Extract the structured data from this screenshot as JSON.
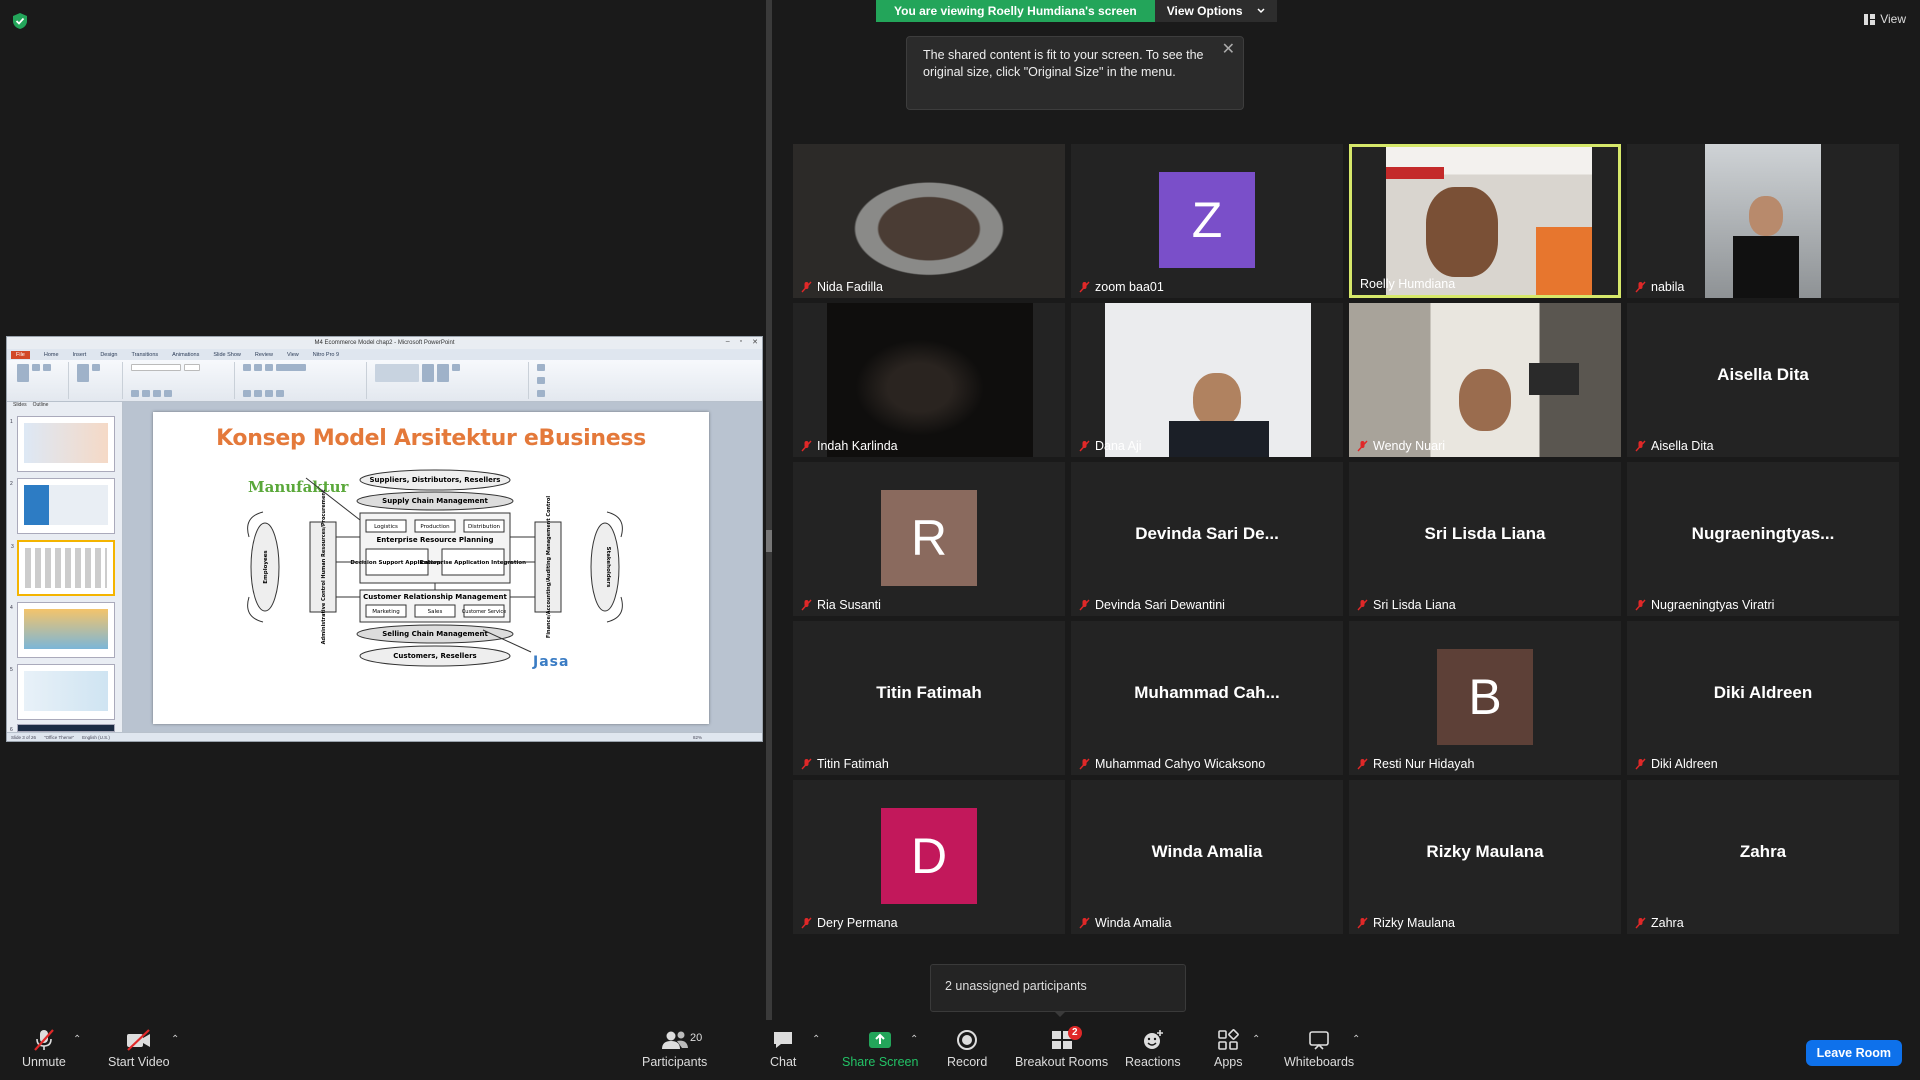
{
  "banner": {
    "viewing": "You are viewing Roelly Humdiana's screen",
    "view_options": "View Options",
    "notice": "The shared content is fit to your screen. To see the original size, click \"Original Size\" in the menu.",
    "view_label": "View"
  },
  "ppt": {
    "window_title": "M4 Ecommerce Model chap2 - Microsoft PowerPoint",
    "tabs": [
      "File",
      "Home",
      "Insert",
      "Design",
      "Transitions",
      "Animations",
      "Slide Show",
      "Review",
      "View",
      "Nitro Pro 9"
    ],
    "panel_tabs": [
      "Slides",
      "Outline"
    ],
    "slide_numbers": [
      "1",
      "2",
      "3",
      "4",
      "5",
      "6"
    ],
    "slide": {
      "title": "Konsep Model Arsitektur eBusiness",
      "manufaktur": "Manufaktur",
      "jasa": "Jasa",
      "boxes": {
        "suppliers": "Suppliers, Distributors, Resellers",
        "scm": "Supply Chain Management",
        "logistics": "Logistics",
        "production": "Production",
        "distribution": "Distribution",
        "erp": "Enterprise Resource Planning",
        "dss": "Decision Support Applications",
        "eai": "Enterprise Application Integration",
        "crm": "Customer Relationship Management",
        "marketing": "Marketing",
        "sales": "Sales",
        "service": "Customer Service",
        "sell_cm": "Selling Chain Management",
        "customers": "Customers, Resellers",
        "employees": "Employees",
        "admin": "Administrative Control Human Resources/Procurement",
        "finance": "Finance/Accounting/Auditing Management Control",
        "stakeholders": "Stakeholders"
      }
    },
    "status": [
      "Slide 3 of 26",
      "\"Office Theme\"",
      "English (U.S.)",
      "82%"
    ]
  },
  "participants": [
    {
      "name": "Nida Fadilla",
      "kind": "video",
      "muted": true
    },
    {
      "name": "zoom baa01",
      "kind": "avatar",
      "letter": "Z",
      "color": "#7a4fc9",
      "muted": true
    },
    {
      "name": "Roelly Humdiana",
      "kind": "video",
      "muted": false,
      "active": true
    },
    {
      "name": "nabila",
      "kind": "video",
      "muted": true
    },
    {
      "name": "Indah Karlinda",
      "kind": "video",
      "muted": true
    },
    {
      "name": "Dana Aji",
      "kind": "video",
      "muted": true
    },
    {
      "name": "Wendy Nuari",
      "kind": "video",
      "muted": true
    },
    {
      "name": "Aisella Dita",
      "kind": "text",
      "display": "Aisella Dita",
      "muted": true
    },
    {
      "name": "Ria Susanti",
      "kind": "avatar",
      "letter": "R",
      "color": "#8a6a5e",
      "muted": true
    },
    {
      "name": "Devinda Sari Dewantini",
      "kind": "text",
      "display": "Devinda Sari De...",
      "muted": true
    },
    {
      "name": "Sri Lisda Liana",
      "kind": "text",
      "display": "Sri Lisda Liana",
      "muted": true
    },
    {
      "name": "Nugraeningtyas Viratri",
      "kind": "text",
      "display": "Nugraeningtyas...",
      "muted": true
    },
    {
      "name": "Titin Fatimah",
      "kind": "text",
      "display": "Titin Fatimah",
      "muted": true
    },
    {
      "name": "Muhammad Cahyo Wicaksono",
      "kind": "text",
      "display": "Muhammad Cah...",
      "muted": true
    },
    {
      "name": "Resti Nur Hidayah",
      "kind": "avatar",
      "letter": "B",
      "color": "#5d4037",
      "muted": true
    },
    {
      "name": "Diki Aldreen",
      "kind": "text",
      "display": "Diki Aldreen",
      "muted": true
    },
    {
      "name": "Dery Permana",
      "kind": "avatar",
      "letter": "D",
      "color": "#c2185b",
      "muted": true
    },
    {
      "name": "Winda Amalia",
      "kind": "text",
      "display": "Winda Amalia",
      "muted": true
    },
    {
      "name": "Rizky Maulana",
      "kind": "text",
      "display": "Rizky Maulana",
      "muted": true
    },
    {
      "name": "Zahra",
      "kind": "text",
      "display": "Zahra",
      "muted": true
    }
  ],
  "unassigned": "2 unassigned participants",
  "toolbar": {
    "unmute": "Unmute",
    "start_video": "Start Video",
    "participants": "Participants",
    "participants_count": "20",
    "chat": "Chat",
    "share_screen": "Share Screen",
    "record": "Record",
    "breakout_rooms": "Breakout Rooms",
    "breakout_badge": "2",
    "reactions": "Reactions",
    "apps": "Apps",
    "whiteboards": "Whiteboards",
    "leave": "Leave Room"
  },
  "colors": {
    "accent_green": "#23a55a",
    "leave_blue": "#0e71eb",
    "active_speaker": "#d6e86a",
    "mute_red": "#e02828"
  }
}
